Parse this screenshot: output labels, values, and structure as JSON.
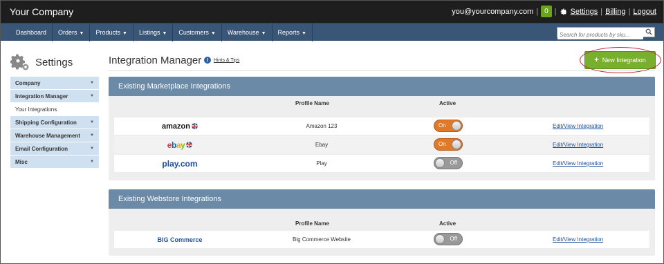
{
  "topbar": {
    "company": "Your Company",
    "email": "you@yourcompany.com",
    "badge": "0",
    "settings": "Settings",
    "billing": "Billing",
    "logout": "Logout"
  },
  "nav": {
    "items": [
      {
        "label": "Dashboard",
        "caret": false
      },
      {
        "label": "Orders",
        "caret": true
      },
      {
        "label": "Products",
        "caret": true
      },
      {
        "label": "Listings",
        "caret": true
      },
      {
        "label": "Customers",
        "caret": true
      },
      {
        "label": "Warehouse",
        "caret": true
      },
      {
        "label": "Reports",
        "caret": true
      }
    ],
    "search_placeholder": "Search for products by sku..."
  },
  "sidebar": {
    "title": "Settings",
    "items": [
      {
        "label": "Company"
      },
      {
        "label": "Integration Manager"
      },
      {
        "label": "Your Integrations"
      },
      {
        "label": "Shipping Configuration"
      },
      {
        "label": "Warehouse Management"
      },
      {
        "label": "Email Configuration"
      },
      {
        "label": "Misc"
      }
    ]
  },
  "main": {
    "title": "Integration Manager",
    "hints": "Hints & Tips",
    "new_button": "New Integration",
    "marketplace": {
      "header": "Existing Marketplace Integrations",
      "col_profile": "Profile Name",
      "col_active": "Active",
      "rows": [
        {
          "logo": "amazon",
          "profile": "Amazon 123",
          "active": "On",
          "edit": "Edit/View Integration"
        },
        {
          "logo": "ebay",
          "profile": "Ebay",
          "active": "On",
          "edit": "Edit/View Integration"
        },
        {
          "logo": "play.com",
          "profile": "Play",
          "active": "Off",
          "edit": "Edit/View Integration"
        }
      ]
    },
    "webstore": {
      "header": "Existing Webstore Integrations",
      "col_profile": "Profile Name",
      "col_active": "Active",
      "rows": [
        {
          "logo": "BIG Commerce",
          "profile": "Big Commerce Website",
          "active": "Off",
          "edit": "Edit/View Integration"
        }
      ]
    }
  },
  "colors": {
    "topbar": "#1e1e1e",
    "navbar": "#3a5677",
    "sidebar_item": "#cfe0f0",
    "panel_header": "#6a8aa8",
    "toggle_on": "#e07a2b",
    "toggle_off": "#999999",
    "new_button": "#78b02e",
    "highlight_ring": "#c0202a"
  }
}
